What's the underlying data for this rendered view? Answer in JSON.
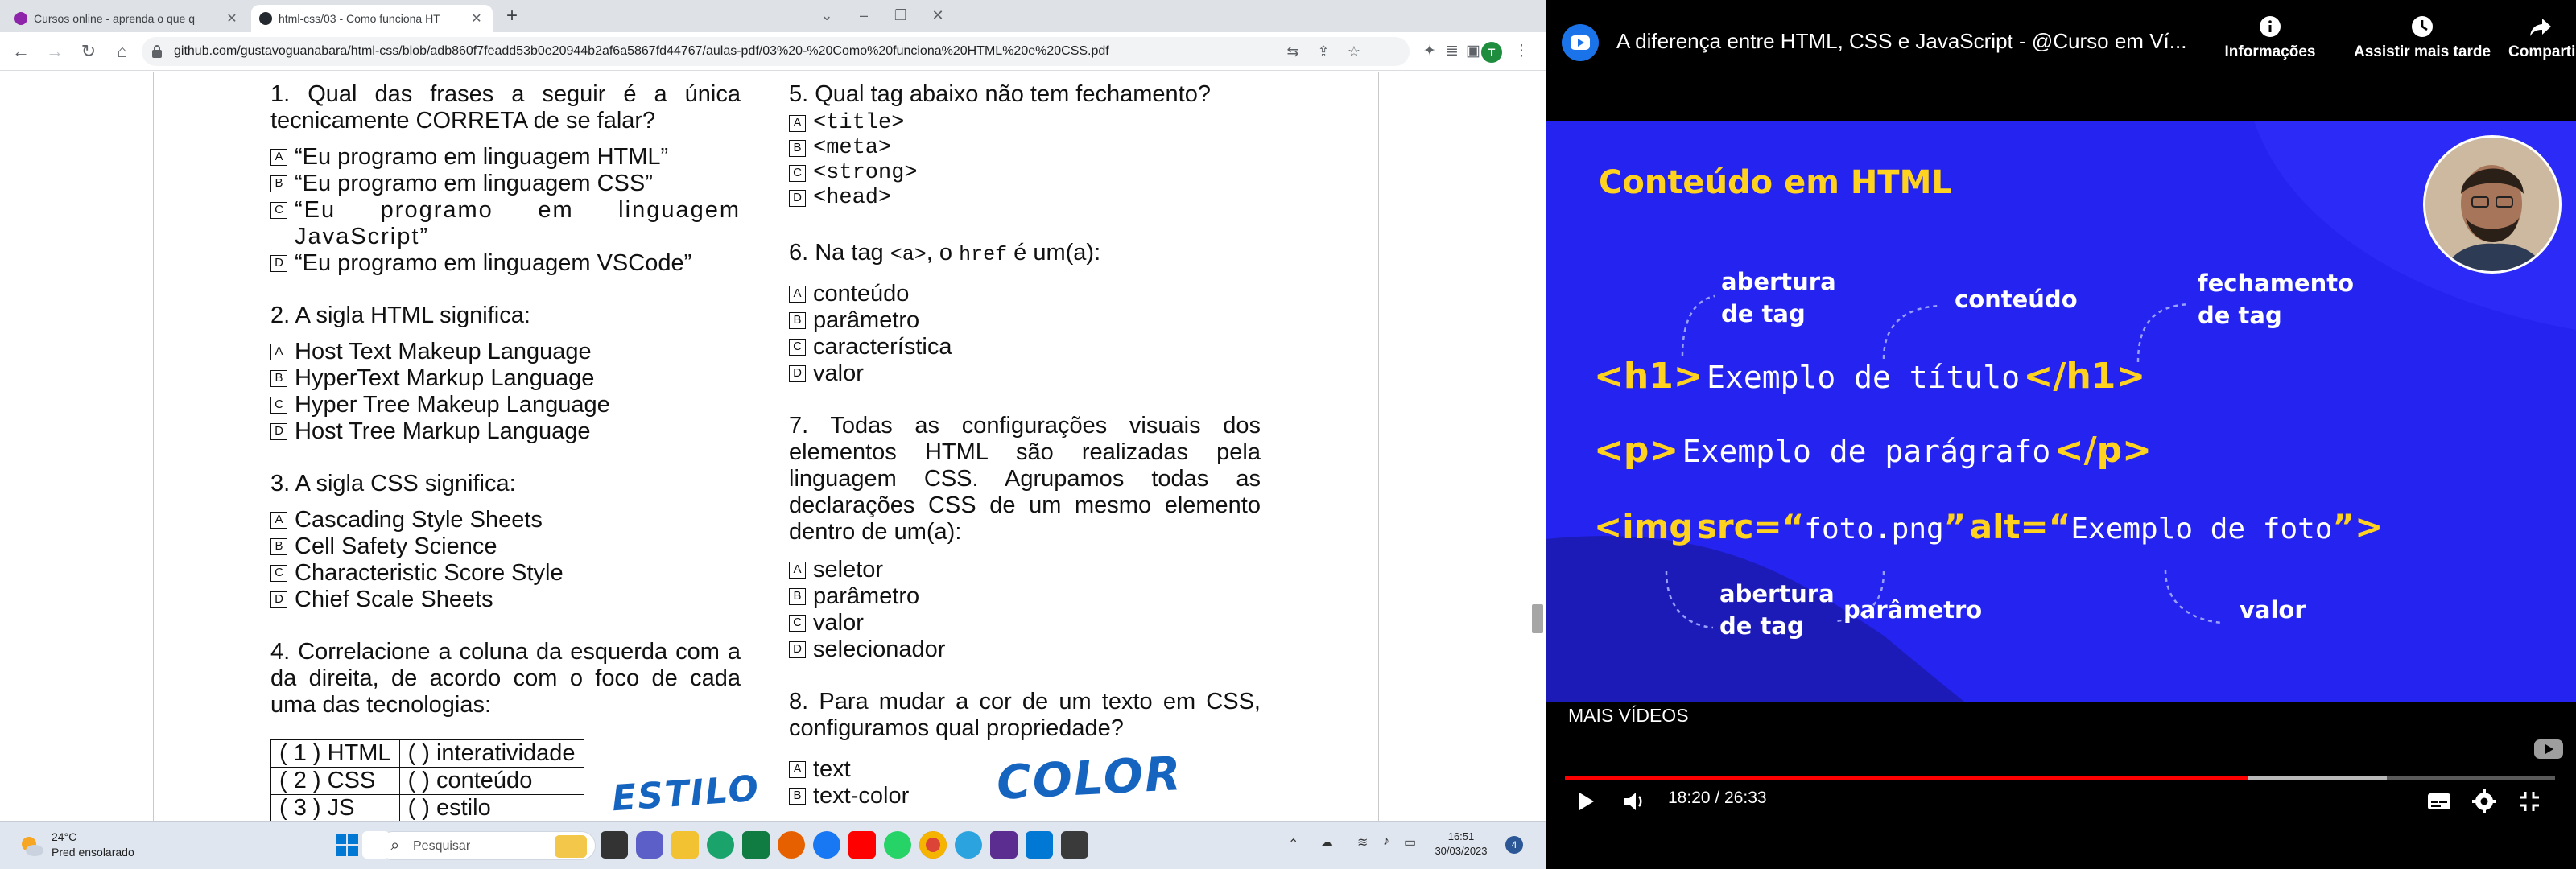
{
  "browser": {
    "tabs": [
      {
        "title": "Cursos online - aprenda o que q",
        "active": false
      },
      {
        "title": "html-css/03 - Como funciona HT",
        "active": true
      }
    ],
    "url": "github.com/gustavoguanabara/html-css/blob/adb860f7feadd53b0e20944b2af6a5867fd44767/aulas-pdf/03%20-%20Como%20funciona%20HTML%20e%20CSS.pdf",
    "profile_initial": "T"
  },
  "pdf": {
    "col1": {
      "q1": {
        "text": "1. Qual das frases a seguir é a única tecnicamente CORRETA de se falar?",
        "options": [
          "“Eu programo em linguagem HTML”",
          "“Eu programo em linguagem CSS”",
          "“Eu programo em linguagem JavaScript”",
          "“Eu programo em linguagem VSCode”"
        ]
      },
      "q2": {
        "text": "2. A sigla HTML significa:",
        "options": [
          "Host Text Makeup Language",
          "HyperText Markup Language",
          "Hyper Tree Makeup Language",
          "Host Tree Markup Language"
        ]
      },
      "q3": {
        "text": "3. A sigla CSS significa:",
        "options": [
          "Cascading Style Sheets",
          "Cell Safety Science",
          "Characteristic Score Style",
          "Chief Scale Sheets"
        ]
      },
      "q4": {
        "text": "4. Correlacione a coluna da esquerda com a da direita, de acordo com o foco de cada uma das tecnologias:",
        "rows": [
          [
            "( 1 ) HTML",
            "(    ) interatividade"
          ],
          [
            "( 2 ) CSS",
            "(    ) conteúdo"
          ],
          [
            "( 3 ) JS",
            "(    ) estilo"
          ]
        ]
      }
    },
    "col2": {
      "q5": {
        "text": "5. Qual tag abaixo não tem fechamento?",
        "options": [
          "<title>",
          "<meta>",
          "<strong>",
          "<head>"
        ]
      },
      "q6": {
        "pre": "6. Na tag ",
        "code1": "<a>",
        "mid": ", o ",
        "code2": "href",
        "post": " é um(a):",
        "options": [
          "conteúdo",
          "parâmetro",
          "característica",
          "valor"
        ]
      },
      "q7": {
        "text": "7. Todas as configurações visuais dos elementos HTML são realizadas pela linguagem CSS. Agrupamos todas as declarações CSS de um mesmo elemento dentro de um(a):",
        "options": [
          "seletor",
          "parâmetro",
          "valor",
          "selecionador"
        ]
      },
      "q8": {
        "text": "8. Para mudar a cor de um texto em CSS, configuramos qual propriedade?",
        "options": [
          "text",
          "text-color"
        ]
      }
    },
    "option_letters": [
      "A",
      "B",
      "C",
      "D"
    ],
    "handwriting": {
      "estilo": "ESTILO",
      "color": "COLOR"
    }
  },
  "taskbar": {
    "weather_temp": "24°C",
    "weather_desc": "Pred ensolarado",
    "search_placeholder": "Pesquisar",
    "time": "16:51",
    "date": "30/03/2023",
    "notification_count": "4"
  },
  "youtube": {
    "title": "A diferença entre HTML, CSS e JavaScript - @Curso em Ví...",
    "actions": [
      "Informações",
      "Assistir mais tarde",
      "Compartilhar"
    ],
    "more_videos": "MAIS VÍDEOS",
    "time_current": "18:20",
    "time_total": "26:33",
    "time_display": "18:20 / 26:33",
    "progress_played": 0.69,
    "progress_buffered": 0.83,
    "slide": {
      "heading": "Conteúdo em HTML",
      "ann_open_top": "abertura\nde tag",
      "ann_content": "conteúdo",
      "ann_close": "fechamento\nde tag",
      "line1_open": "<h1>",
      "line1_text": "Exemplo de título",
      "line1_close": "</h1>",
      "line2_open": "<p>",
      "line2_text": "Exemplo de parágrafo",
      "line2_close": "</p>",
      "line3_tag": "<img",
      "line3_attr1": "src=“",
      "line3_val1": "foto.png",
      "line3_q1": "”",
      "line3_attr2": "alt=“",
      "line3_val2": "Exemplo de foto",
      "line3_end": "”>",
      "ann_open_bottom": "abertura\nde tag",
      "ann_param": "parâmetro",
      "ann_value": "valor"
    }
  }
}
